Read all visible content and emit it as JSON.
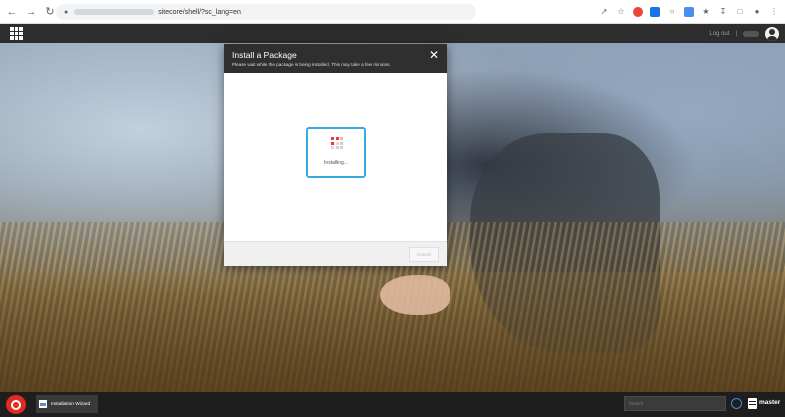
{
  "browser": {
    "url_visible": "sitecore/shell/?sc_lang=en"
  },
  "topbar": {
    "logout_label": "Log out"
  },
  "dialog": {
    "title": "Install a Package",
    "subtitle": "Please wait while the package is being installed. This may take a few minutes.",
    "progress_label": "Installing...",
    "cancel_label": "Cancel",
    "dot_colors": [
      "#e03a3a",
      "#e03a3a",
      "#f0b0b0",
      "#e03a3a",
      "#f4d0d0",
      "#d0d0d0",
      "#f4d0d0",
      "#d0d0d0",
      "#d0d0d0"
    ]
  },
  "taskbar": {
    "task_item_label": "Installation Wizard",
    "search_placeholder": "Search",
    "database_label": "master"
  },
  "colors": {
    "accent_blue": "#38a9e0",
    "sitecore_red": "#e02b20",
    "header_dark": "#2f2f2f"
  }
}
